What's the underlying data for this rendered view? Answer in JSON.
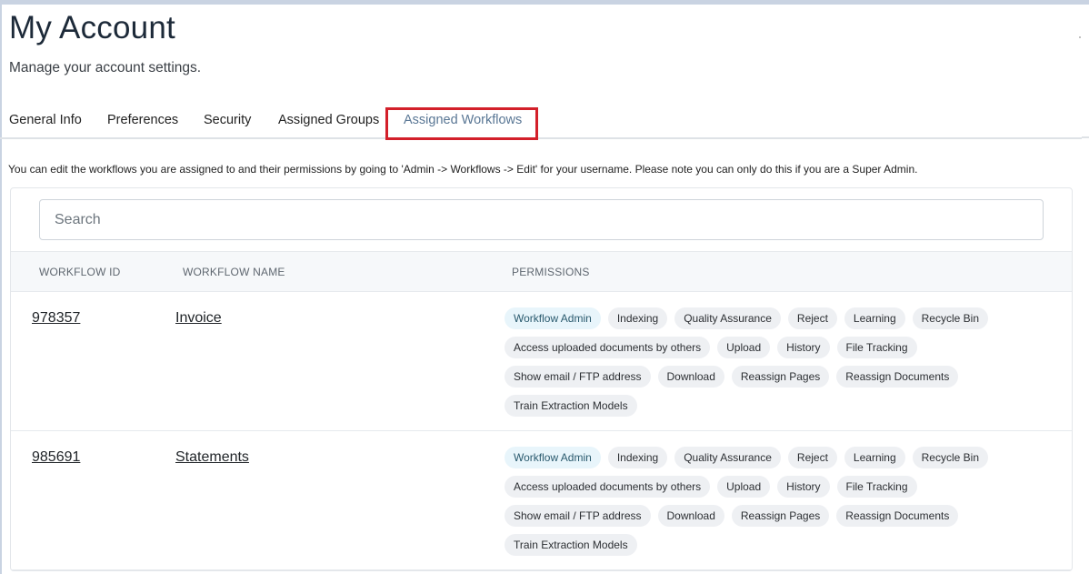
{
  "header": {
    "title": "My Account",
    "subtitle": "Manage your account settings."
  },
  "tabs": [
    {
      "label": "General Info"
    },
    {
      "label": "Preferences"
    },
    {
      "label": "Security"
    },
    {
      "label": "Assigned Groups"
    },
    {
      "label": "Assigned Workflows",
      "active": true
    }
  ],
  "info_text": "You can edit the workflows you are assigned to and their permissions by going to 'Admin -> Workflows -> Edit' for your username. Please note you can only do this if you are a Super Admin.",
  "search": {
    "placeholder": "Search"
  },
  "table": {
    "columns": [
      "WORKFLOW ID",
      "WORKFLOW NAME",
      "PERMISSIONS"
    ],
    "rows": [
      {
        "id": "978357",
        "name": "Invoice",
        "permissions": [
          [
            "Workflow Admin",
            "Indexing",
            "Quality Assurance",
            "Reject",
            "Learning",
            "Recycle Bin"
          ],
          [
            "Access uploaded documents by others",
            "Upload",
            "History",
            "File Tracking"
          ],
          [
            "Show email / FTP address",
            "Download",
            "Reassign Pages",
            "Reassign Documents"
          ],
          [
            "Train Extraction Models"
          ]
        ]
      },
      {
        "id": "985691",
        "name": "Statements",
        "permissions": [
          [
            "Workflow Admin",
            "Indexing",
            "Quality Assurance",
            "Reject",
            "Learning",
            "Recycle Bin"
          ],
          [
            "Access uploaded documents by others",
            "Upload",
            "History",
            "File Tracking"
          ],
          [
            "Show email / FTP address",
            "Download",
            "Reassign Pages",
            "Reassign Documents"
          ],
          [
            "Train Extraction Models"
          ]
        ]
      }
    ]
  },
  "colors": {
    "highlight_box": "#d3202a",
    "active_tab": "#5a7795",
    "admin_chip_bg": "#e8f5fb",
    "chip_bg": "#eef0f3"
  }
}
